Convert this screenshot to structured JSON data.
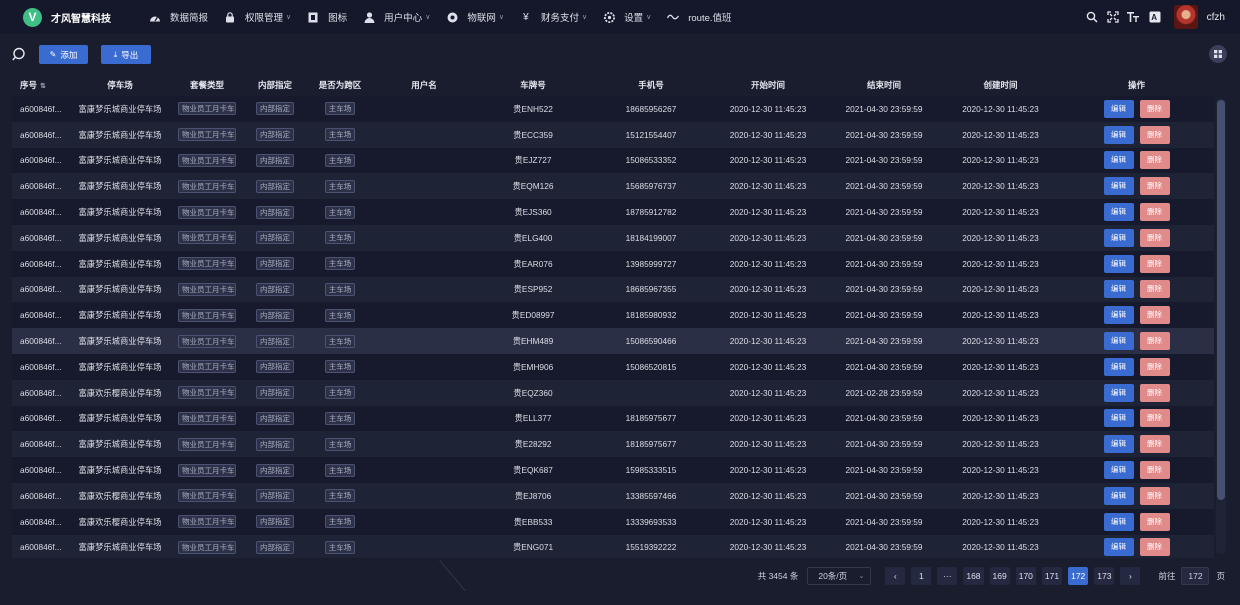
{
  "brand": {
    "logo_letter": "V",
    "name": "才风智慧科技"
  },
  "menu": [
    {
      "label": "数据简报",
      "icon": "dashboard-icon",
      "dropdown": false
    },
    {
      "label": "权限管理",
      "icon": "lock-icon",
      "dropdown": true
    },
    {
      "label": "图标",
      "icon": "picture-icon",
      "dropdown": false
    },
    {
      "label": "用户中心",
      "icon": "user-icon",
      "dropdown": true
    },
    {
      "label": "物联网",
      "icon": "globe-icon",
      "dropdown": true
    },
    {
      "label": "财务支付",
      "icon": "yen-icon",
      "dropdown": true
    },
    {
      "label": "设置",
      "icon": "gear-icon",
      "dropdown": true
    },
    {
      "label": "route.值班",
      "icon": "wave-icon",
      "dropdown": false
    }
  ],
  "user": {
    "name": "cfzh"
  },
  "toolbar": {
    "add_label": "添加",
    "export_label": "导出"
  },
  "table": {
    "columns": [
      "序号",
      "停车场",
      "套餐类型",
      "内部指定",
      "是否为跨区",
      "用户名",
      "车牌号",
      "手机号",
      "开始时间",
      "结束时间",
      "创建时间",
      "操作"
    ],
    "edit_label": "编辑",
    "delete_label": "删除",
    "rows": [
      {
        "id": "a600846f...",
        "lot": "富康梦乐城商业停车场",
        "plan": "物业员工月卡车",
        "internal": "内部指定",
        "cross": "主车场",
        "user": "",
        "plate": "贵ENH522",
        "phone": "18685956267",
        "start": "2020-12-30 11:45:23",
        "end": "2021-04-30 23:59:59",
        "created": "2020-12-30 11:45:23"
      },
      {
        "id": "a600846f...",
        "lot": "富康梦乐城商业停车场",
        "plan": "物业员工月卡车",
        "internal": "内部指定",
        "cross": "主车场",
        "user": "",
        "plate": "贵ECC359",
        "phone": "15121554407",
        "start": "2020-12-30 11:45:23",
        "end": "2021-04-30 23:59:59",
        "created": "2020-12-30 11:45:23"
      },
      {
        "id": "a600846f...",
        "lot": "富康梦乐城商业停车场",
        "plan": "物业员工月卡车",
        "internal": "内部指定",
        "cross": "主车场",
        "user": "",
        "plate": "贵EJZ727",
        "phone": "15086533352",
        "start": "2020-12-30 11:45:23",
        "end": "2021-04-30 23:59:59",
        "created": "2020-12-30 11:45:23"
      },
      {
        "id": "a600846f...",
        "lot": "富康梦乐城商业停车场",
        "plan": "物业员工月卡车",
        "internal": "内部指定",
        "cross": "主车场",
        "user": "",
        "plate": "贵EQM126",
        "phone": "15685976737",
        "start": "2020-12-30 11:45:23",
        "end": "2021-04-30 23:59:59",
        "created": "2020-12-30 11:45:23"
      },
      {
        "id": "a600846f...",
        "lot": "富康梦乐城商业停车场",
        "plan": "物业员工月卡车",
        "internal": "内部指定",
        "cross": "主车场",
        "user": "",
        "plate": "贵EJS360",
        "phone": "18785912782",
        "start": "2020-12-30 11:45:23",
        "end": "2021-04-30 23:59:59",
        "created": "2020-12-30 11:45:23"
      },
      {
        "id": "a600846f...",
        "lot": "富康梦乐城商业停车场",
        "plan": "物业员工月卡车",
        "internal": "内部指定",
        "cross": "主车场",
        "user": "",
        "plate": "贵ELG400",
        "phone": "18184199007",
        "start": "2020-12-30 11:45:23",
        "end": "2021-04-30 23:59:59",
        "created": "2020-12-30 11:45:23"
      },
      {
        "id": "a600846f...",
        "lot": "富康梦乐城商业停车场",
        "plan": "物业员工月卡车",
        "internal": "内部指定",
        "cross": "主车场",
        "user": "",
        "plate": "贵EAR076",
        "phone": "13985999727",
        "start": "2020-12-30 11:45:23",
        "end": "2021-04-30 23:59:59",
        "created": "2020-12-30 11:45:23"
      },
      {
        "id": "a600846f...",
        "lot": "富康梦乐城商业停车场",
        "plan": "物业员工月卡车",
        "internal": "内部指定",
        "cross": "主车场",
        "user": "",
        "plate": "贵ESP952",
        "phone": "18685967355",
        "start": "2020-12-30 11:45:23",
        "end": "2021-04-30 23:59:59",
        "created": "2020-12-30 11:45:23"
      },
      {
        "id": "a600846f...",
        "lot": "富康梦乐城商业停车场",
        "plan": "物业员工月卡车",
        "internal": "内部指定",
        "cross": "主车场",
        "user": "",
        "plate": "贵ED08997",
        "phone": "18185980932",
        "start": "2020-12-30 11:45:23",
        "end": "2021-04-30 23:59:59",
        "created": "2020-12-30 11:45:23"
      },
      {
        "id": "a600846f...",
        "lot": "富康梦乐城商业停车场",
        "plan": "物业员工月卡车",
        "internal": "内部指定",
        "cross": "主车场",
        "user": "",
        "plate": "贵EHM489",
        "phone": "15086590466",
        "start": "2020-12-30 11:45:23",
        "end": "2021-04-30 23:59:59",
        "created": "2020-12-30 11:45:23"
      },
      {
        "id": "a600846f...",
        "lot": "富康梦乐城商业停车场",
        "plan": "物业员工月卡车",
        "internal": "内部指定",
        "cross": "主车场",
        "user": "",
        "plate": "贵EMH906",
        "phone": "15086520815",
        "start": "2020-12-30 11:45:23",
        "end": "2021-04-30 23:59:59",
        "created": "2020-12-30 11:45:23"
      },
      {
        "id": "a600846f...",
        "lot": "富康欢乐樱商业停车场",
        "plan": "物业员工月卡车",
        "internal": "内部指定",
        "cross": "主车场",
        "user": "",
        "plate": "贵EQZ360",
        "phone": "",
        "start": "2020-12-30 11:45:23",
        "end": "2021-02-28 23:59:59",
        "created": "2020-12-30 11:45:23"
      },
      {
        "id": "a600846f...",
        "lot": "富康梦乐城商业停车场",
        "plan": "物业员工月卡车",
        "internal": "内部指定",
        "cross": "主车场",
        "user": "",
        "plate": "贵ELL377",
        "phone": "18185975677",
        "start": "2020-12-30 11:45:23",
        "end": "2021-04-30 23:59:59",
        "created": "2020-12-30 11:45:23"
      },
      {
        "id": "a600846f...",
        "lot": "富康梦乐城商业停车场",
        "plan": "物业员工月卡车",
        "internal": "内部指定",
        "cross": "主车场",
        "user": "",
        "plate": "贵E28292",
        "phone": "18185975677",
        "start": "2020-12-30 11:45:23",
        "end": "2021-04-30 23:59:59",
        "created": "2020-12-30 11:45:23"
      },
      {
        "id": "a600846f...",
        "lot": "富康梦乐城商业停车场",
        "plan": "物业员工月卡车",
        "internal": "内部指定",
        "cross": "主车场",
        "user": "",
        "plate": "贵EQK687",
        "phone": "15985333515",
        "start": "2020-12-30 11:45:23",
        "end": "2021-04-30 23:59:59",
        "created": "2020-12-30 11:45:23"
      },
      {
        "id": "a600846f...",
        "lot": "富康欢乐樱商业停车场",
        "plan": "物业员工月卡车",
        "internal": "内部指定",
        "cross": "主车场",
        "user": "",
        "plate": "贵EJ8706",
        "phone": "13385597466",
        "start": "2020-12-30 11:45:23",
        "end": "2021-04-30 23:59:59",
        "created": "2020-12-30 11:45:23"
      },
      {
        "id": "a600846f...",
        "lot": "富康欢乐樱商业停车场",
        "plan": "物业员工月卡车",
        "internal": "内部指定",
        "cross": "主车场",
        "user": "",
        "plate": "贵EBB533",
        "phone": "13339693533",
        "start": "2020-12-30 11:45:23",
        "end": "2021-04-30 23:59:59",
        "created": "2020-12-30 11:45:23"
      },
      {
        "id": "a600846f...",
        "lot": "富康梦乐城商业停车场",
        "plan": "物业员工月卡车",
        "internal": "内部指定",
        "cross": "主车场",
        "user": "",
        "plate": "贵ENG071",
        "phone": "15519392222",
        "start": "2020-12-30 11:45:23",
        "end": "2021-04-30 23:59:59",
        "created": "2020-12-30 11:45:23"
      }
    ]
  },
  "pagination": {
    "total_text": "共 3454 条",
    "page_size": "20条/页",
    "pages": [
      "1",
      "···",
      "168",
      "169",
      "170",
      "171",
      "172",
      "173"
    ],
    "active_page": "172",
    "goto_label": "前往",
    "goto_value": "172",
    "page_unit": "页"
  },
  "colors": {
    "background": "#1a1d2e",
    "topbar": "#15182a",
    "primary": "#3a6bd1",
    "danger": "#e08a8a",
    "logo": "#3fbf86"
  }
}
